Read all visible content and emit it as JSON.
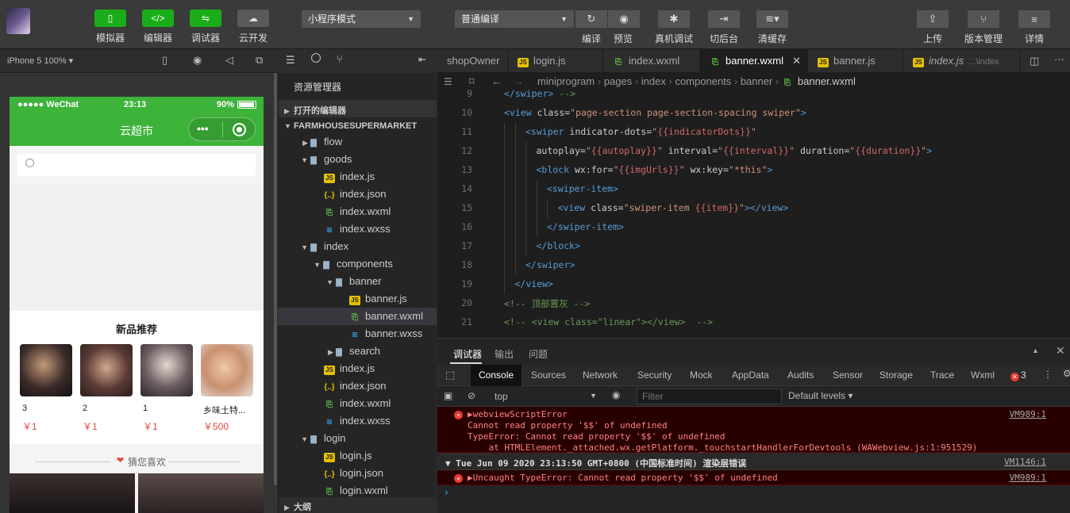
{
  "toolbar": {
    "buttons": [
      {
        "label": "模拟器",
        "icon": "phone-icon"
      },
      {
        "label": "编辑器",
        "icon": "code-icon"
      },
      {
        "label": "调试器",
        "icon": "debug-icon"
      },
      {
        "label": "云开发",
        "icon": "cloud-icon"
      }
    ],
    "mode_select": "小程序模式",
    "compile_select": "普通编译",
    "compile_label": "编译",
    "preview_label": "预览",
    "realdebug_label": "真机调试",
    "background_label": "切后台",
    "clearcache_label": "清缓存",
    "upload_label": "上传",
    "version_label": "版本管理",
    "details_label": "详情"
  },
  "simulator": {
    "device": "iPhone 5 100% ▾",
    "status_carrier": "●●●●● WeChat",
    "status_time": "23:13",
    "status_battery": "90%",
    "nav_title": "云超市",
    "new_products_title": "新品推荐",
    "products": [
      {
        "name": "3",
        "price": "￥1"
      },
      {
        "name": "2",
        "price": "￥1"
      },
      {
        "name": "1",
        "price": "￥1"
      },
      {
        "name": "乡味土特...",
        "price": "￥500"
      }
    ],
    "guess_title": "猜您喜欢"
  },
  "explorer": {
    "title": "资源管理器",
    "open_editors": "打开的编辑器",
    "project": "FARMHOUSESUPERMARKET",
    "outline": "大纲",
    "tree": [
      {
        "label": "flow",
        "type": "folder",
        "indent": 0,
        "open": false
      },
      {
        "label": "goods",
        "type": "folder",
        "indent": 0,
        "open": true
      },
      {
        "label": "index.js",
        "type": "js",
        "indent": 1
      },
      {
        "label": "index.json",
        "type": "json",
        "indent": 1
      },
      {
        "label": "index.wxml",
        "type": "wxml",
        "indent": 1
      },
      {
        "label": "index.wxss",
        "type": "wxss",
        "indent": 1
      },
      {
        "label": "index",
        "type": "folder",
        "indent": 0,
        "open": true
      },
      {
        "label": "components",
        "type": "folder",
        "indent": 1,
        "open": true
      },
      {
        "label": "banner",
        "type": "folder",
        "indent": 2,
        "open": true
      },
      {
        "label": "banner.js",
        "type": "js",
        "indent": 3
      },
      {
        "label": "banner.wxml",
        "type": "wxml",
        "indent": 3,
        "selected": true
      },
      {
        "label": "banner.wxss",
        "type": "wxss",
        "indent": 3
      },
      {
        "label": "search",
        "type": "folder",
        "indent": 2,
        "open": false
      },
      {
        "label": "index.js",
        "type": "js",
        "indent": 1
      },
      {
        "label": "index.json",
        "type": "json",
        "indent": 1
      },
      {
        "label": "index.wxml",
        "type": "wxml",
        "indent": 1
      },
      {
        "label": "index.wxss",
        "type": "wxss",
        "indent": 1
      },
      {
        "label": "login",
        "type": "folder",
        "indent": 0,
        "open": true
      },
      {
        "label": "login.js",
        "type": "js",
        "indent": 1
      },
      {
        "label": "login.json",
        "type": "json",
        "indent": 1
      },
      {
        "label": "login.wxml",
        "type": "wxml",
        "indent": 1
      }
    ]
  },
  "editor": {
    "tabs": [
      {
        "label": "shopOwner",
        "type": "none"
      },
      {
        "label": "login.js",
        "type": "js"
      },
      {
        "label": "index.wxml",
        "type": "wxml"
      },
      {
        "label": "banner.wxml",
        "type": "wxml",
        "active": true
      },
      {
        "label": "banner.js",
        "type": "js"
      },
      {
        "label": "index.js",
        "type": "js",
        "suffix": "...\\index"
      }
    ],
    "breadcrumb": [
      "miniprogram",
      "pages",
      "index",
      "components",
      "banner",
      "banner.wxml"
    ],
    "lines": [
      {
        "n": "9",
        "indent": 1,
        "html": "<span class='t'>&lt;/swiper&gt;</span> <span class='c'>--&gt;</span>"
      },
      {
        "n": "10",
        "indent": 1,
        "html": "<span class='t'>&lt;view</span> <span class='a'>class=</span><span class='s'>\"page-section page-section-spacing swiper\"</span><span class='t'>&gt;</span>"
      },
      {
        "n": "11",
        "indent": 3,
        "html": "<span class='t'>&lt;swiper</span> <span class='a'>indicator-dots=</span><span class='s'>\"</span><span class='b'>{{indicatorDots}}</span><span class='s'>\"</span>"
      },
      {
        "n": "12",
        "indent": 4,
        "html": "<span class='a'>autoplay=</span><span class='s'>\"</span><span class='b'>{{autoplay}}</span><span class='s'>\"</span> <span class='a'>interval=</span><span class='s'>\"</span><span class='b'>{{interval}}</span><span class='s'>\"</span> <span class='a'>duration=</span><span class='s'>\"</span><span class='b'>{{duration}}</span><span class='s'>\"</span><span class='t'>&gt;</span>"
      },
      {
        "n": "13",
        "indent": 4,
        "html": "<span class='t'>&lt;block</span> <span class='a'>wx:for=</span><span class='s'>\"</span><span class='b'>{{imgUrls}}</span><span class='s'>\"</span> <span class='a'>wx:key=</span><span class='s'>\"*this\"</span><span class='t'>&gt;</span>"
      },
      {
        "n": "14",
        "indent": 5,
        "html": "<span class='t'>&lt;swiper-item&gt;</span>"
      },
      {
        "n": "15",
        "indent": 6,
        "html": "<span class='t'>&lt;view</span> <span class='a'>class=</span><span class='s'>\"swiper-item </span><span class='b'>{{item}}</span><span class='s'>\"</span><span class='t'>&gt;&lt;/view&gt;</span>"
      },
      {
        "n": "16",
        "indent": 5,
        "html": "<span class='t'>&lt;/swiper-item&gt;</span>"
      },
      {
        "n": "17",
        "indent": 4,
        "html": "<span class='t'>&lt;/block&gt;</span>"
      },
      {
        "n": "18",
        "indent": 3,
        "html": "<span class='t'>&lt;/swiper&gt;</span>"
      },
      {
        "n": "19",
        "indent": 2,
        "html": "<span class='t'>&lt;/view&gt;</span>"
      },
      {
        "n": "20",
        "indent": 1,
        "html": "<span class='c'>&lt;!-- 顶部置灰 --&gt;</span>"
      },
      {
        "n": "21",
        "indent": 1,
        "html": "<span class='c'>&lt;!-- &lt;view class=\"linear\"&gt;&lt;/view&gt;  --&gt;</span>"
      }
    ]
  },
  "panel": {
    "tabs": [
      "调试器",
      "输出",
      "问题"
    ],
    "devtools_tabs": [
      "Console",
      "Sources",
      "Network",
      "Security",
      "Mock",
      "AppData",
      "Audits",
      "Sensor",
      "Storage",
      "Trace",
      "Wxml"
    ],
    "error_count": "3",
    "context": "top",
    "filter_placeholder": "Filter",
    "levels": "Default levels ▾",
    "errors": {
      "e1_title": "▶webviewScriptError",
      "e1_l2": "Cannot read property '$$' of undefined",
      "e1_l3": "TypeError: Cannot read property '$$' of undefined",
      "e1_l4": "    at HTMLElement._attached.wx.getPlatform._touchstartHandlerForDevtools (WAWebview.js:1:951529)",
      "e1_src": "VM989:1",
      "group_title": "▼ Tue Jun 09 2020 23:13:50 GMT+0800 (中国标准时间) 渲染层错误",
      "group_src": "VM1146:1",
      "e2_title": "▶Uncaught TypeError: Cannot read property '$$' of undefined",
      "e2_src": "VM989:1"
    },
    "prompt": "›"
  },
  "colors": {
    "wechat_green": "#3db33a",
    "toolbar_green": "#1aad19",
    "price_red": "#e64340"
  }
}
